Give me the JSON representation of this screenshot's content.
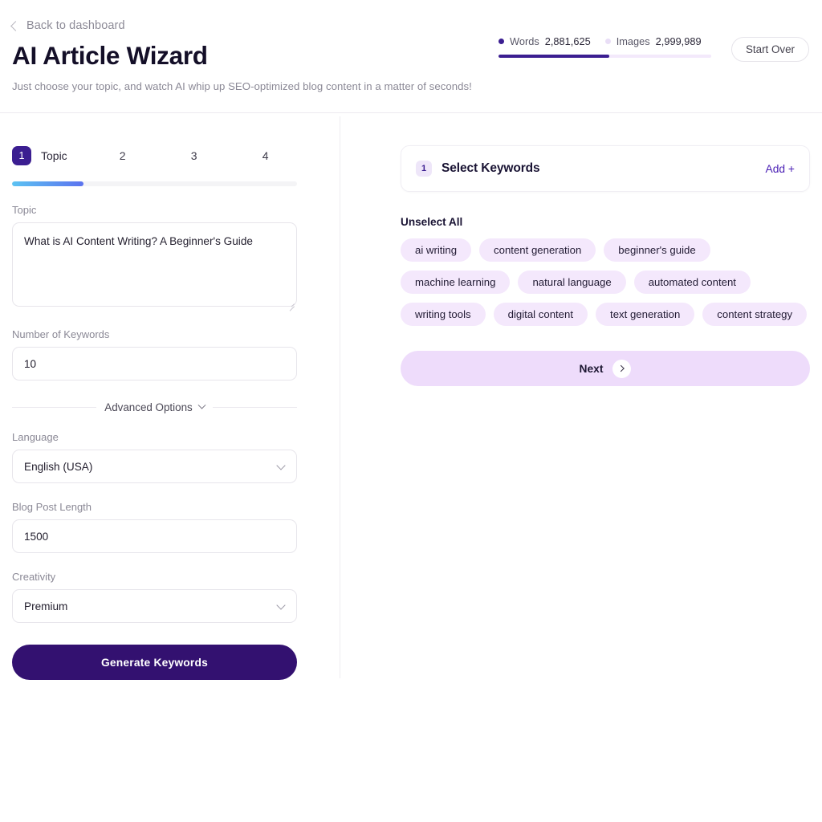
{
  "header": {
    "back_label": "Back to dashboard",
    "title": "AI Article Wizard",
    "subtitle": "Just choose your topic, and watch AI whip up SEO-optimized blog content in a matter of seconds!",
    "start_over_label": "Start Over",
    "usage": {
      "words_label": "Words",
      "words_value": "2,881,625",
      "images_label": "Images",
      "images_value": "2,999,989",
      "bar_fill_percent": 52,
      "words_color": "#3b1e91",
      "images_color": "#e9def6"
    }
  },
  "wizard": {
    "steps": [
      {
        "number": "1",
        "label": "Topic"
      },
      {
        "number": "2",
        "label": ""
      },
      {
        "number": "3",
        "label": ""
      },
      {
        "number": "4",
        "label": ""
      }
    ],
    "progress_percent": 25,
    "progress_gradient_from": "#5cc3f2",
    "progress_gradient_to": "#5c73ef"
  },
  "form": {
    "topic": {
      "label": "Topic",
      "value": "What is AI Content Writing? A Beginner's Guide",
      "placeholder": ""
    },
    "keyword_count": {
      "label": "Number of Keywords",
      "value": "10",
      "placeholder": ""
    },
    "advanced_options_label": "Advanced Options",
    "language": {
      "label": "Language",
      "value": "English (USA)"
    },
    "blog_length": {
      "label": "Blog Post Length",
      "value": "1500",
      "placeholder": ""
    },
    "creativity": {
      "label": "Creativity",
      "value": "Premium"
    },
    "generate_label": "Generate Keywords"
  },
  "keywords_panel": {
    "badge": "1",
    "title": "Select Keywords",
    "add_label": "Add +",
    "unselect_all_label": "Unselect All",
    "chips": [
      "ai writing",
      "content generation",
      "beginner's guide",
      "machine learning",
      "natural language",
      "automated content",
      "writing tools",
      "digital content",
      "text generation",
      "content strategy"
    ],
    "next_label": "Next"
  }
}
